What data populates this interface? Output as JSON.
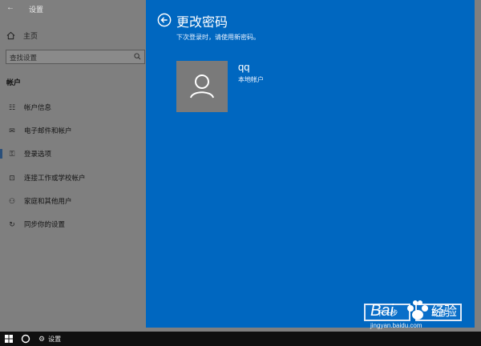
{
  "window": {
    "title": "设置"
  },
  "sidebar": {
    "home": "主页",
    "search_placeholder": "查找设置",
    "section": "帐户",
    "items": [
      {
        "label": "帐户信息",
        "icon": "account-info-icon"
      },
      {
        "label": "电子邮件和帐户",
        "icon": "mail-icon"
      },
      {
        "label": "登录选项",
        "icon": "key-icon"
      },
      {
        "label": "连接工作或学校帐户",
        "icon": "briefcase-icon"
      },
      {
        "label": "家庭和其他用户",
        "icon": "add-person-icon"
      },
      {
        "label": "同步你的设置",
        "icon": "sync-icon"
      }
    ],
    "active_index": 2
  },
  "dialog": {
    "title": "更改密码",
    "subtitle": "下次登录时，请使用新密码。",
    "account_name": "qq",
    "account_type": "本地帐户",
    "next_button": "下一步",
    "cancel_button": "取消",
    "bg_color": "#0067c0"
  },
  "watermark": {
    "brand": "Bai 经验",
    "url": "jingyan.baidu.com"
  },
  "taskbar": {
    "app_label": "设置"
  }
}
